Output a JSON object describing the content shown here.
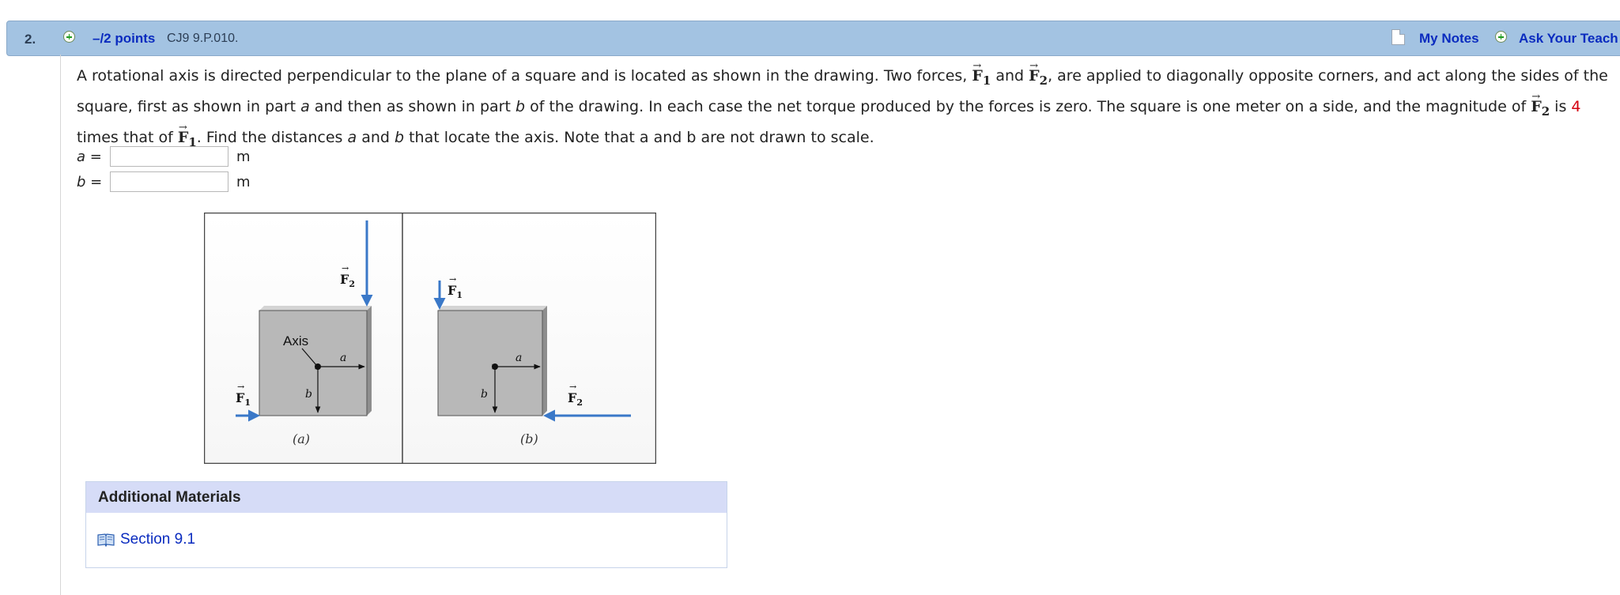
{
  "question": {
    "number": "2.",
    "points": "–/2 points",
    "id": "CJ9 9.P.010.",
    "my_notes": "My Notes",
    "ask_teacher": "Ask Your Teach"
  },
  "problem": {
    "p1": "A rotational axis is directed perpendicular to the plane of a square and is located as shown in the drawing. Two forces, ",
    "f1": "F",
    "f1_sub": "1",
    "and": " and ",
    "f2": "F",
    "f2_sub": "2",
    "p2": ", are applied to diagonally opposite corners, and act along the sides of the square, first as shown in part ",
    "a": "a",
    "p3": " and then as shown in part ",
    "b": "b",
    "p4": " of the drawing. In each case the net torque produced by the forces is zero. The square is one meter on a side, and the magnitude of ",
    "p5": " is ",
    "multiplier": "4",
    "p6": " times that of ",
    "p7": ". Find the distances ",
    "p8": " and ",
    "p9": " that locate the axis. Note that a and b are not drawn to scale."
  },
  "answers": [
    {
      "var": "a",
      "eq": " =",
      "value": "",
      "unit": "m"
    },
    {
      "var": "b",
      "eq": " =",
      "value": "",
      "unit": "m"
    }
  ],
  "figure": {
    "axis_label": "Axis",
    "a_label": "a",
    "b_label": "b",
    "f1": "F",
    "f2": "F",
    "sub1": "1",
    "sub2": "2",
    "cap_a": "(a)",
    "cap_b": "(b)"
  },
  "additional": {
    "header": "Additional Materials",
    "link": "Section 9.1"
  },
  "colors": {
    "bar": "#a3c3e2",
    "link": "#0a2bbf",
    "arrow": "#3a78c8",
    "square": "#b8b8b8",
    "accent_red": "#d4000f"
  }
}
